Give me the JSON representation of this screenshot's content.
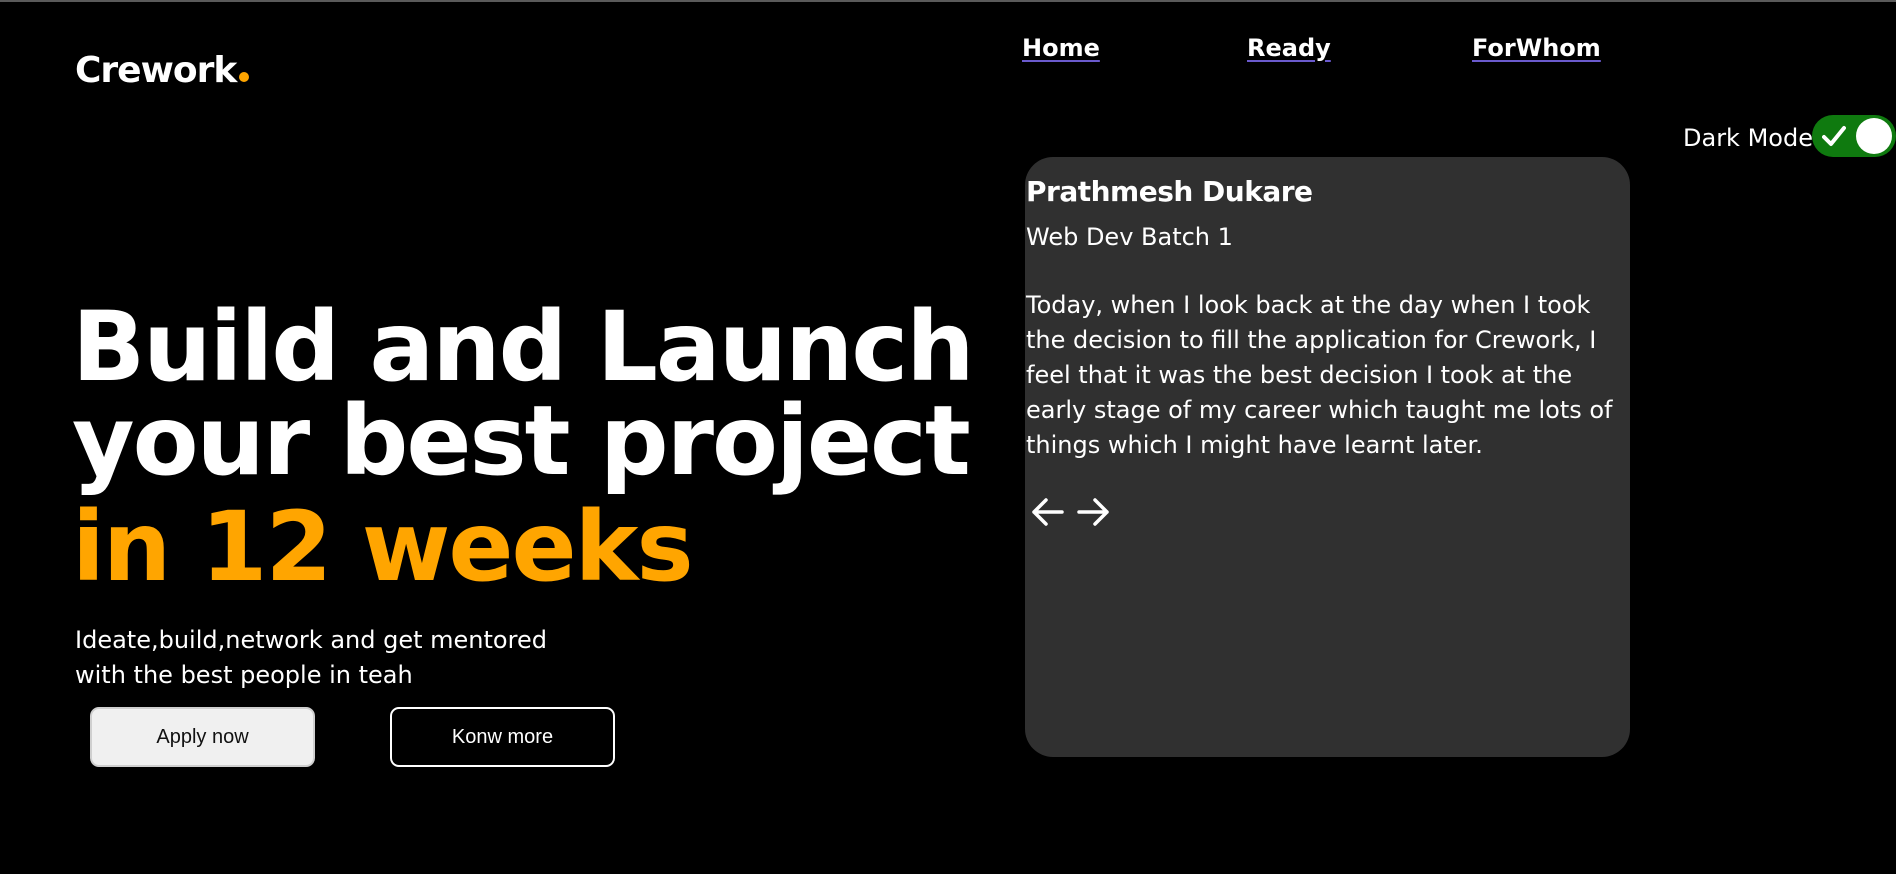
{
  "brand": {
    "logo_text": "Crework",
    "accent_color": "#FFA500"
  },
  "nav": {
    "items": [
      {
        "label": "Home"
      },
      {
        "label": "Ready"
      },
      {
        "label": "ForWhom"
      }
    ]
  },
  "theme_toggle": {
    "label": "Dark Mode",
    "state": "on",
    "on_color": "#0f7a0f",
    "check_icon": "check-icon"
  },
  "hero": {
    "title_line1": "Build and Launch",
    "title_line2": "your best project",
    "title_accent": "in 12 weeks",
    "subtitle": "Ideate,build,network and get mentored with the best people in teah",
    "primary_button": "Apply now",
    "secondary_button": "Konw more"
  },
  "testimonial": {
    "name": "Prathmesh Dukare",
    "batch": "Web Dev Batch 1",
    "quote": "Today, when I look back at the day when I took the decision to fill the application for Crework, I feel that it was the best decision I took at the early stage of my career which taught me lots of things which I might have learnt later.",
    "card_color": "#303030",
    "prev_icon": "arrow-left-icon",
    "next_icon": "arrow-right-icon"
  }
}
